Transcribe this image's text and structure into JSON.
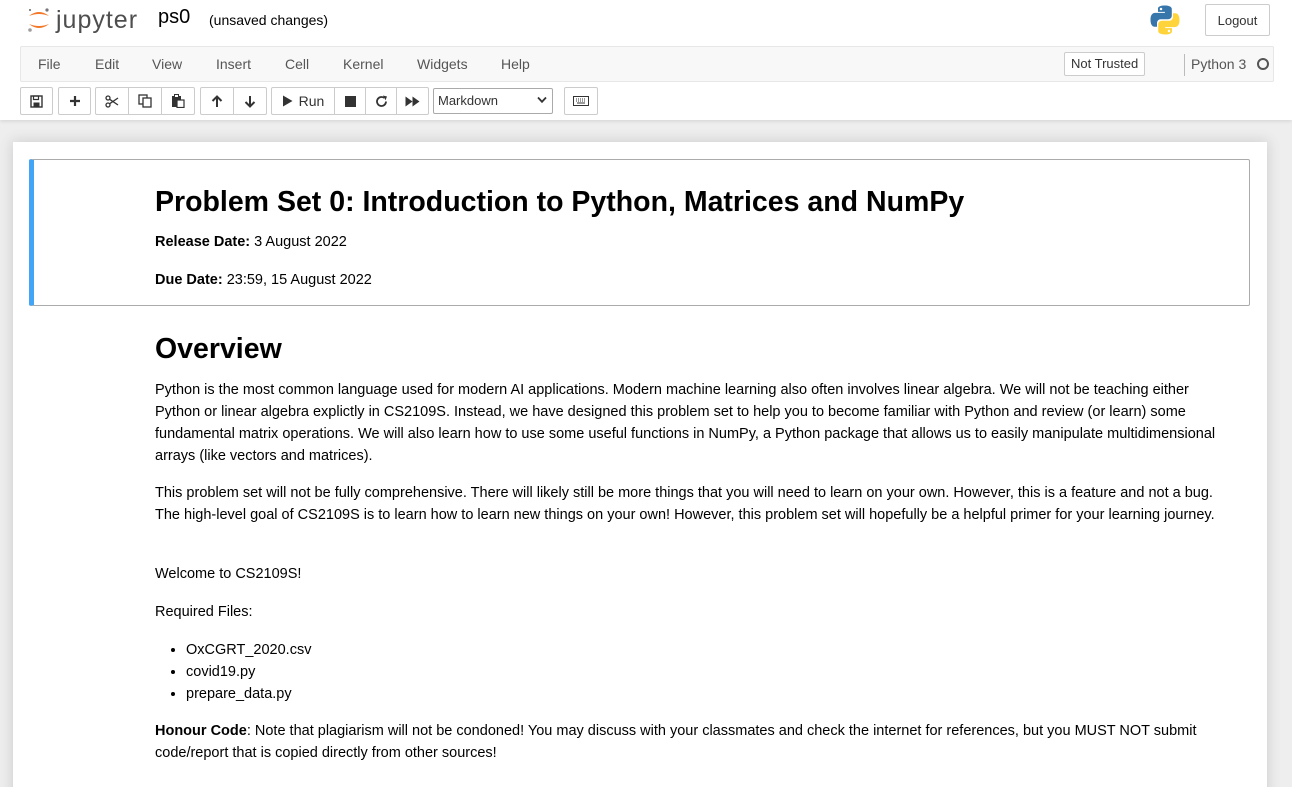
{
  "header": {
    "logo_text": "jupyter",
    "notebook_name": "ps0",
    "save_status": "(unsaved changes)",
    "logout_label": "Logout"
  },
  "menubar": {
    "items": [
      "File",
      "Edit",
      "View",
      "Insert",
      "Cell",
      "Kernel",
      "Widgets",
      "Help"
    ],
    "trust_label": "Not Trusted",
    "kernel_name": "Python 3"
  },
  "toolbar": {
    "run_label": "Run",
    "cell_type": "Markdown",
    "icons": [
      "save-icon",
      "plus-icon",
      "cut-icon",
      "copy-icon",
      "paste-icon",
      "arrow-up-icon",
      "arrow-down-icon",
      "play-icon",
      "stop-icon",
      "restart-icon",
      "fast-forward-icon",
      "keyboard-icon"
    ]
  },
  "cells": {
    "title": "Problem Set 0: Introduction to Python, Matrices and NumPy",
    "release_label": "Release Date:",
    "release_value": " 3 August 2022",
    "due_label": "Due Date:",
    "due_value": " 23:59, 15 August 2022",
    "overview_heading": "Overview",
    "para1": "Python is the most common language used for modern AI applications. Modern machine learning also often involves linear algebra. We will not be teaching either Python or linear algebra explictly in CS2109S. Instead, we have designed this problem set to help you to become familiar with Python and review (or learn) some fundamental matrix operations. We will also learn how to use some useful functions in NumPy, a Python package that allows us to easily manipulate multidimensional arrays (like vectors and matrices).",
    "para2": "This problem set will not be fully comprehensive. There will likely still be more things that you will need to learn on your own. However, this is a feature and not a bug. The high-level goal of CS2109S is to learn how to learn new things on your own! However, this problem set will hopefully be a helpful primer for your learning journey.",
    "welcome": "Welcome to CS2109S!",
    "required_files_label": "Required Files:",
    "required_files": [
      "OxCGRT_2020.csv",
      "covid19.py",
      "prepare_data.py"
    ],
    "honour_label": "Honour Code",
    "honour_text": ": Note that plagiarism will not be condoned! You may discuss with your classmates and check the internet for references, but you MUST NOT submit code/report that is copied directly from other sources!"
  }
}
